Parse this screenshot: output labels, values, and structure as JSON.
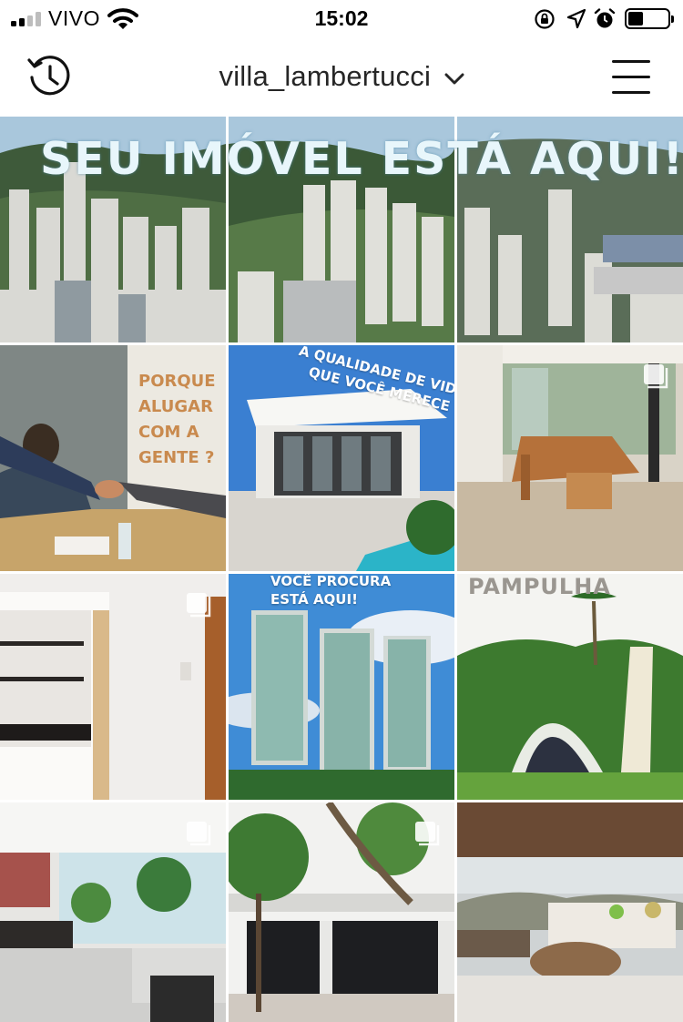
{
  "status_bar": {
    "carrier": "VIVO",
    "time": "15:02",
    "icons": [
      "signal-bars",
      "wifi",
      "orientation-lock",
      "location-arrow",
      "alarm-clock",
      "battery"
    ],
    "battery_level": 0.25
  },
  "header": {
    "username": "villa_lambertucci",
    "left_icon": "history-icon",
    "dropdown_icon": "chevron-down-icon",
    "right_icon": "menu-icon"
  },
  "posts": {
    "banner_text": "SEU IMÓVEL ESTÁ AQUI!",
    "post_4_text": [
      "PORQUE",
      "ALUGAR",
      "COM A",
      "GENTE ?"
    ],
    "post_5_text": [
      "A QUALIDADE DE VIDA",
      "QUE VOCÊ MERECE"
    ],
    "post_8_text": [
      "VOCÊ PROCURA",
      "ESTÁ AQUI!"
    ],
    "post_9_text": "PAMPULHA",
    "multi_photo_icon": "multiple-photos-icon"
  },
  "colors": {
    "text_primary": "#262626",
    "rent_text": "#c98a4e",
    "banner_text": "#e8f6fb",
    "overlay_white": "#ffffff"
  }
}
